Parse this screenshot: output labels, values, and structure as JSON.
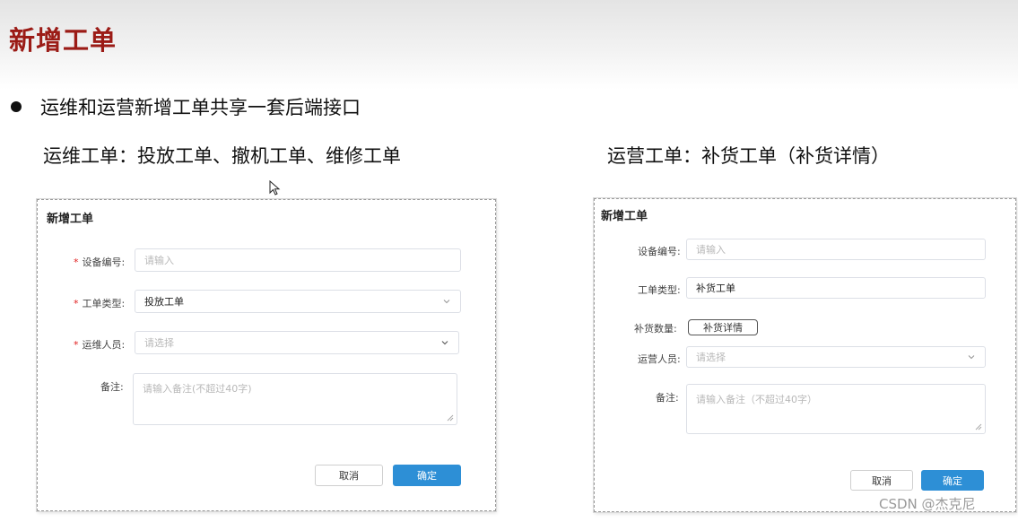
{
  "slide": {
    "title": "新增工单",
    "bullet": "运维和运营新增工单共享一套后端接口",
    "left_heading": "运维工单：投放工单、撤机工单、维修工单",
    "right_heading": "运营工单：补货工单（补货详情）"
  },
  "ops_dialog": {
    "title": "新增工单",
    "device_label": "设备编号:",
    "device_placeholder": "请输入",
    "type_label": "工单类型:",
    "type_value": "投放工单",
    "staff_label": "运维人员:",
    "staff_placeholder": "请选择",
    "remark_label": "备注:",
    "remark_placeholder": "请输入备注(不超过40字)",
    "cancel_label": "取消",
    "confirm_label": "确定"
  },
  "run_dialog": {
    "title": "新增工单",
    "device_label": "设备编号:",
    "device_placeholder": "请输入",
    "type_label": "工单类型:",
    "type_value": "补货工单",
    "qty_label": "补货数量:",
    "detail_button": "补货详情",
    "staff_label": "运营人员:",
    "staff_placeholder": "请选择",
    "remark_label": "备注:",
    "remark_placeholder": "请输入备注（不超过40字）",
    "cancel_label": "取消",
    "confirm_label": "确定"
  },
  "watermark": "CSDN @杰克尼",
  "icons": {
    "bullet": "bullet-dot-icon",
    "cursor": "mouse-cursor-icon",
    "dropdown": "chevron-down-icon",
    "resize": "resize-grip-icon"
  },
  "colors": {
    "title_red": "#9b1b16",
    "primary_blue": "#2d8fd6",
    "required_red": "#e02020"
  }
}
